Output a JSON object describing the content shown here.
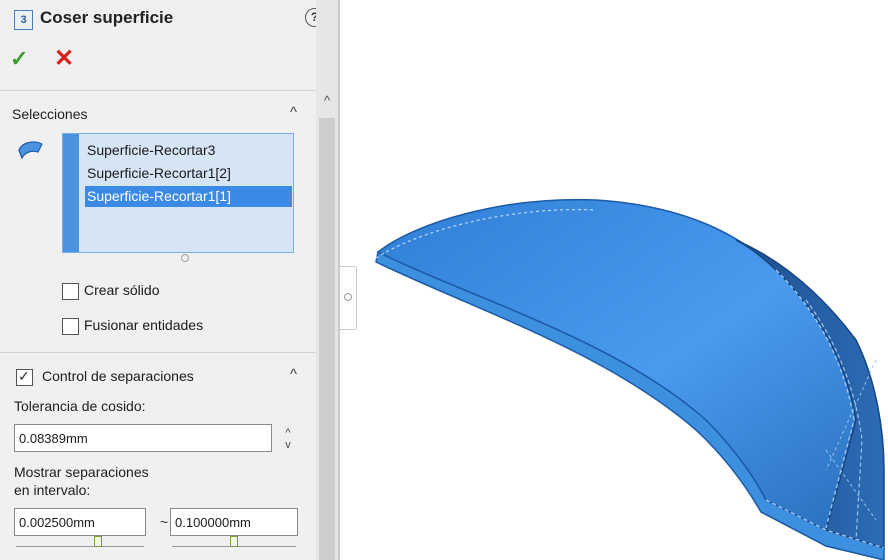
{
  "panel": {
    "title": "Coser superficie",
    "title_icon_glyph": "3",
    "help_glyph": "?",
    "ok_glyph": "✓",
    "cancel_glyph": "✕",
    "selections": {
      "title": "Selecciones",
      "collapse_glyph": "^",
      "items": [
        {
          "label": "Superficie-Recortar3",
          "selected": false
        },
        {
          "label": "Superficie-Recortar1[2]",
          "selected": false
        },
        {
          "label": "Superficie-Recortar1[1]",
          "selected": true
        }
      ],
      "create_solid": {
        "label": "Crear sólido",
        "checked": false
      },
      "merge_entities": {
        "label": "Fusionar entidades",
        "checked": false
      }
    },
    "gap_control": {
      "title": "Control de separaciones",
      "checked": true,
      "collapse_glyph": "^",
      "tolerance_label": "Tolerancia de cosido:",
      "tolerance_value": "0.08389mm",
      "spinner_up": "^",
      "spinner_down": "v",
      "range_label_line1": "Mostrar separaciones",
      "range_label_line2": "en intervalo:",
      "range_min": "0.002500mm",
      "range_separator": "~",
      "range_max": "0.100000mm"
    },
    "scrollbar_arrow": "^"
  },
  "colors": {
    "accent": "#3b8ae6",
    "selection_bg": "#d5e5f5",
    "ok": "#3aa02e",
    "cancel": "#d6201c",
    "surface": "#3d8fe0"
  }
}
